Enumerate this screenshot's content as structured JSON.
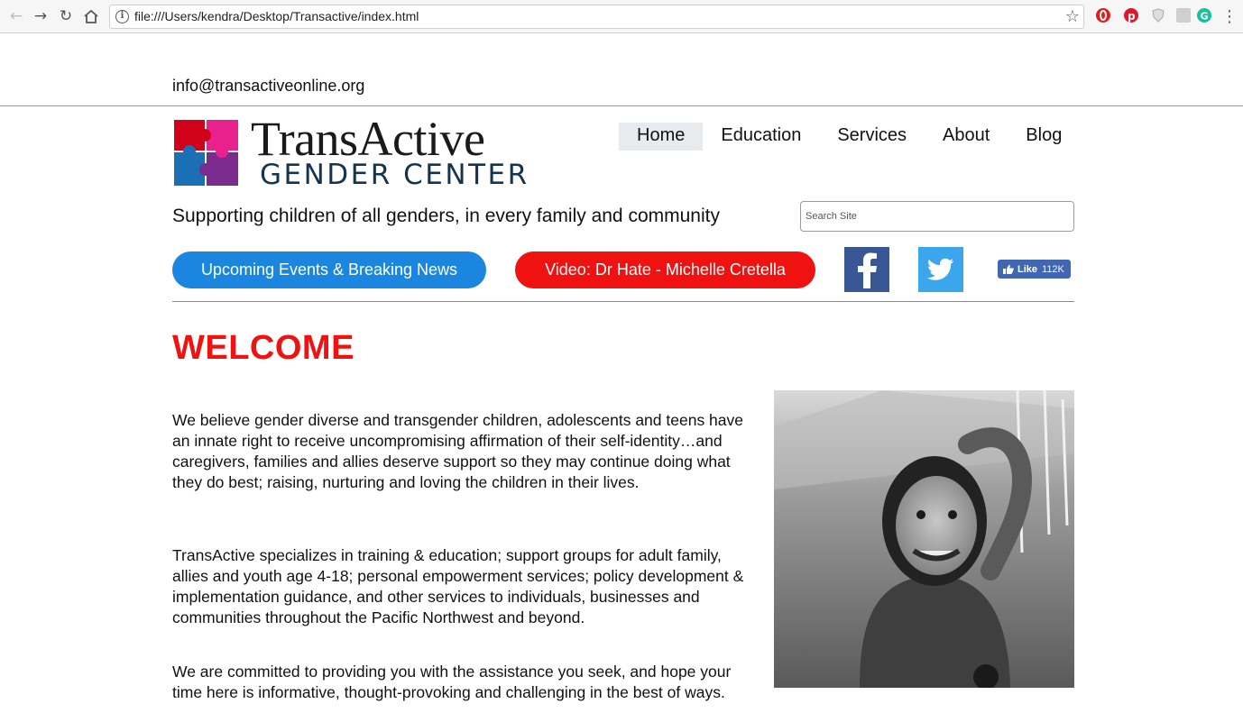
{
  "browser": {
    "url": "file:///Users/kendra/Desktop/Transactive/index.html"
  },
  "header": {
    "email": "info@transactiveonline.org"
  },
  "logo": {
    "title": "TransActive",
    "subtitle": "GENDER CENTER",
    "colors": [
      "#d0021b",
      "#e8218c",
      "#1b6fb5",
      "#7b2a8e"
    ]
  },
  "nav": {
    "items": [
      {
        "label": "Home",
        "active": true
      },
      {
        "label": "Education",
        "active": false
      },
      {
        "label": "Services",
        "active": false
      },
      {
        "label": "About",
        "active": false
      },
      {
        "label": "Blog",
        "active": false
      }
    ]
  },
  "tagline": "Supporting children of all genders, in every family and community",
  "search": {
    "placeholder": "Search Site",
    "value": ""
  },
  "buttons": {
    "events": "Upcoming Events & Breaking News",
    "video": "Video: Dr Hate - Michelle Cretella"
  },
  "social": {
    "facebook_icon": "facebook-icon",
    "twitter_icon": "twitter-icon",
    "like_label": "Like",
    "like_count": "112K"
  },
  "content": {
    "heading": "WELCOME",
    "paragraphs": [
      "We believe gender diverse and transgender children, adolescents and teens have an innate right to receive uncompromising affirmation of their self-identity…and caregivers, families and allies deserve support so they may continue doing what they do best; raising, nurturing and loving the children in their lives.",
      "TransActive specializes in training & education; support groups for adult family, allies and youth age 4-18; personal empowerment services; policy development & implementation guidance, and other services to individuals, businesses and communities throughout the Pacific Northwest and beyond.",
      "We are committed to providing you with the assistance you seek, and hope your time here is informative, thought-provoking and challenging in the best of ways."
    ]
  },
  "colors": {
    "accent_red": "#f01111",
    "accent_blue": "#1a86e0",
    "facebook": "#3a5795",
    "twitter": "#3ba6ec"
  }
}
